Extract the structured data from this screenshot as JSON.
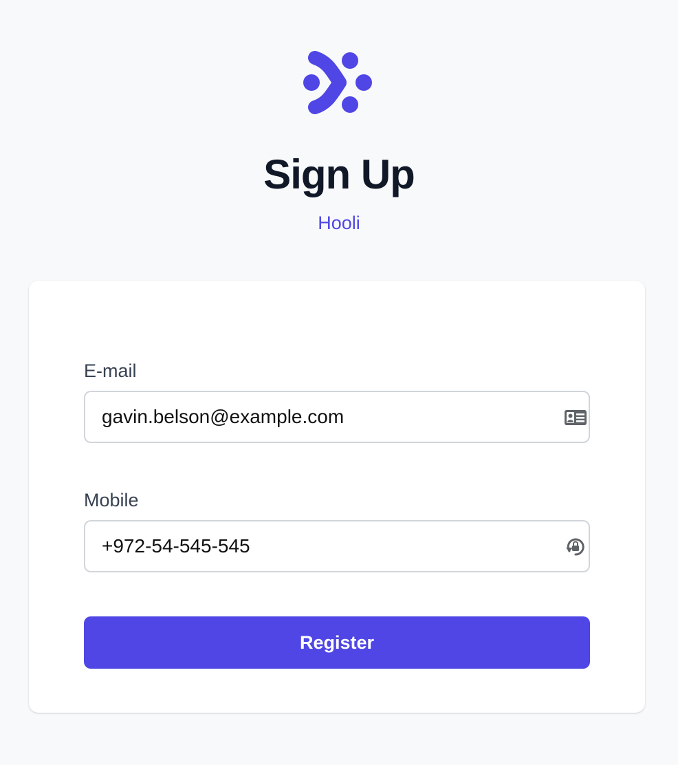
{
  "brand": {
    "logo_icon": "network-nodes-logo",
    "accent_color": "#4f46e5"
  },
  "header": {
    "title": "Sign Up",
    "organization": "Hooli"
  },
  "form": {
    "email": {
      "label": "E-mail",
      "value": "gavin.belson@example.com",
      "icon": "contact-card-icon"
    },
    "mobile": {
      "label": "Mobile",
      "value": "+972-54-545-545",
      "icon": "password-manager-icon"
    },
    "submit_label": "Register"
  }
}
